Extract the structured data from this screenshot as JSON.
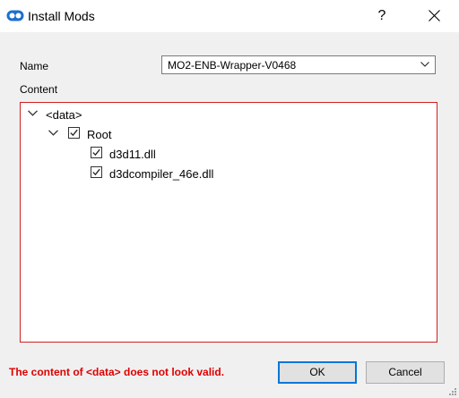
{
  "window": {
    "title": "Install Mods",
    "help_label": "?",
    "accent_color": "#0078d7",
    "error_color": "#e00000"
  },
  "form": {
    "name_label": "Name",
    "name_value": "MO2-ENB-Wrapper-V0468",
    "content_label": "Content"
  },
  "tree": {
    "root": {
      "label": "<data>",
      "expanded": true
    },
    "folder": {
      "label": "Root",
      "checked": true,
      "expanded": true
    },
    "files": [
      {
        "label": "d3d11.dll",
        "checked": true
      },
      {
        "label": "d3dcompiler_46e.dll",
        "checked": true
      }
    ]
  },
  "status": {
    "error_message": "The content of <data> does not look valid."
  },
  "buttons": {
    "ok_label": "OK",
    "cancel_label": "Cancel"
  }
}
